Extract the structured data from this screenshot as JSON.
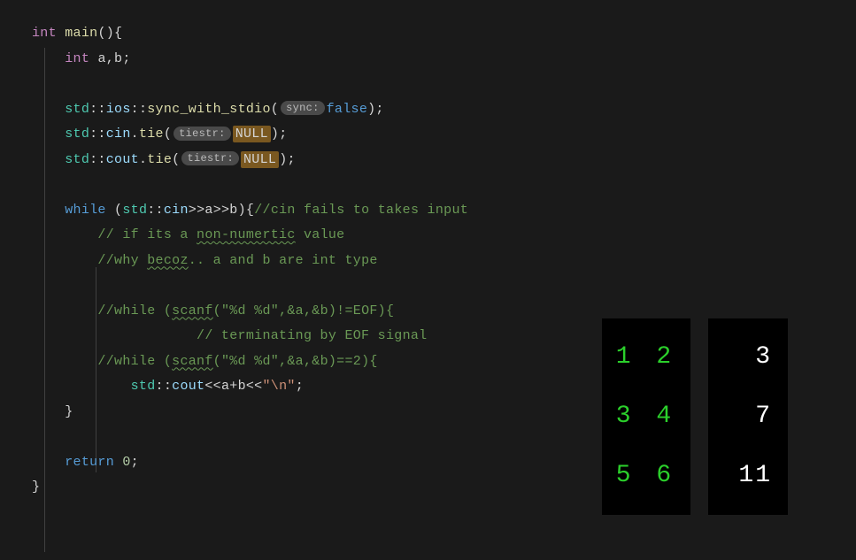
{
  "code": {
    "l1": {
      "type": "int",
      "fn": "main",
      "parens": "(){"
    },
    "l2": {
      "type": "int",
      "vars": "a,b;"
    },
    "l3": {
      "ns1": "std",
      "prop1": "ios",
      "fn": "sync_with_stdio",
      "hint": "sync:",
      "val": "false",
      "tail": ");"
    },
    "l4": {
      "ns1": "std",
      "prop1": "cin",
      "fn": "tie",
      "hint": "tiestr:",
      "val": "NULL",
      "tail": ");"
    },
    "l5": {
      "ns1": "std",
      "prop1": "cout",
      "fn": "tie",
      "hint": "tiestr:",
      "val": "NULL",
      "tail": ");"
    },
    "l6": {
      "kw": "while",
      "ns": "std",
      "prop": "cin",
      "var1": "a",
      "var2": "b",
      "comment": "//cin fails to takes input"
    },
    "l7": {
      "comment_pre": "// if its a ",
      "comment_sq": "non-numertic",
      "comment_post": " value"
    },
    "l8": {
      "comment_pre": "//why ",
      "comment_sq": "becoz",
      "comment_post": ".. a and b are int type"
    },
    "l9": {
      "comment_pre": "//while (",
      "comment_sq": "scanf",
      "comment_post": "(\"%d %d\",&a,&b)!=EOF){"
    },
    "l10": {
      "comment": "// terminating by EOF signal"
    },
    "l11": {
      "comment_pre": "//while (",
      "comment_sq": "scanf",
      "comment_post": "(\"%d %d\",&a,&b)==2){"
    },
    "l12": {
      "ns": "std",
      "prop": "cout",
      "expr": "a+b",
      "str": "\"\\n\"",
      "tail": ";"
    },
    "l13": {
      "brace": "}"
    },
    "l14": {
      "kw": "return",
      "num": "0",
      "tail": ";"
    },
    "l15": {
      "brace": "}"
    }
  },
  "terminal": {
    "input": [
      "1 2",
      "3 4",
      "5 6"
    ],
    "output": [
      "3",
      "7",
      "11"
    ]
  }
}
